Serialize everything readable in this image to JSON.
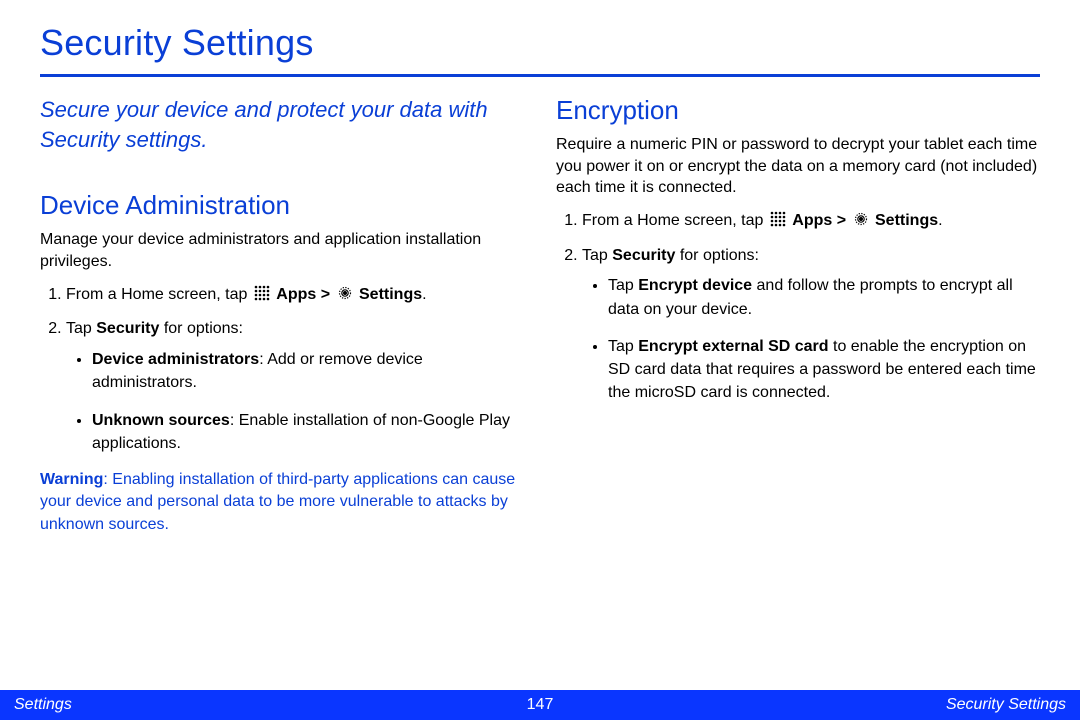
{
  "title": "Security Settings",
  "tagline": "Secure your device and protect your data with Security settings.",
  "device_admin": {
    "heading": "Device Administration",
    "intro": "Manage your device administrators and application installation privileges.",
    "step1_prefix": "From a Home screen, tap ",
    "apps_label": "Apps",
    "gt": ">",
    "settings_label": "Settings",
    "period": ".",
    "step2_a": "Tap ",
    "step2_b": "Security",
    "step2_c": " for options:",
    "bullet1_a": "Device administrators",
    "bullet1_b": ": Add or remove device administrators.",
    "bullet2_a": "Unknown sources",
    "bullet2_b": ": Enable installation of non-Google Play applications.",
    "warning_label": "Warning",
    "warning_text": ": Enabling installation of third-party applications can cause your device and personal data to be more vulnerable to attacks by unknown sources."
  },
  "encryption": {
    "heading": "Encryption",
    "intro": "Require a numeric PIN or password to decrypt your tablet each time you power it on or encrypt the data on a memory card (not included) each time it is connected.",
    "step1_prefix": "From a Home screen, tap ",
    "apps_label": "Apps",
    "gt": ">",
    "settings_label": "Settings",
    "period": ".",
    "step2_a": "Tap ",
    "step2_b": "Security",
    "step2_c": " for options:",
    "bullet1_a": "Tap ",
    "bullet1_b": "Encrypt device",
    "bullet1_c": " and follow the prompts to encrypt all data on your device.",
    "bullet2_a": "Tap ",
    "bullet2_b": "Encrypt external SD card",
    "bullet2_c": " to enable the encryption on SD card data that requires a password be entered each time the microSD card is connected."
  },
  "footer": {
    "left": "Settings",
    "center": "147",
    "right": "Security Settings"
  }
}
